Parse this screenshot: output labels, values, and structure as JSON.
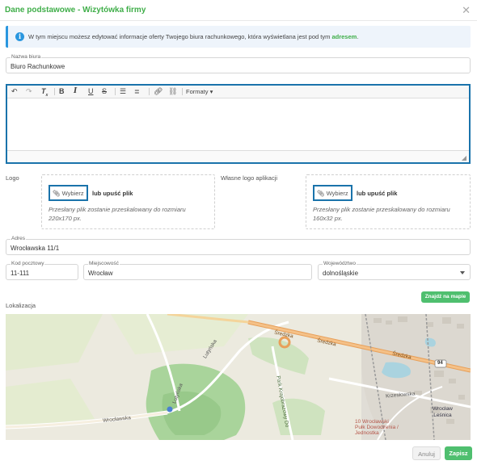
{
  "dialog": {
    "title": "Dane podstawowe - Wizytówka firmy"
  },
  "info": {
    "text": "W tym miejscu możesz edytować informacje oferty Twojego biura rachunkowego, która wyświetlana jest pod tym",
    "link": "adresem",
    "end": "."
  },
  "office": {
    "label": "Nazwa biura",
    "value": "Biuro Rachunkowe"
  },
  "editor": {
    "formats_label": "Formaty",
    "content": ""
  },
  "logo": {
    "label": "Logo",
    "choose_label": "Wybierz",
    "or_drop": "lub upuść plik",
    "hint_line1": "Przesłany plik zostanie przeskalowany do rozmiaru",
    "hint_line2": "220x170 px."
  },
  "app_logo": {
    "label": "Własne logo aplikacji",
    "choose_label": "Wybierz",
    "or_drop": "lub upuść plik",
    "hint_line1": "Przesłany plik zostanie przeskalowany do rozmiaru",
    "hint_line2": "160x32 px."
  },
  "address": {
    "street_label": "Adres",
    "street_value": "Wrocławska 11/1",
    "postal_label": "Kod pocztowy",
    "postal_value": "11-111",
    "city_label": "Miejscowość",
    "city_value": "Wrocław",
    "province_label": "Województwo",
    "province_value": "dolnośląskie"
  },
  "location": {
    "label": "Lokalizacja",
    "find_label": "Znajdź na mapie"
  },
  "map": {
    "labels": {
      "sredzka_1": "Średzka",
      "sredzka_2": "Średzka",
      "sredzka_3": "Średzka",
      "lutynska_1": "Lutyńska",
      "lutynska_2": "Lutyńska",
      "wroclawska": "Wrocławska",
      "park": "Park Krajobrazowy Do",
      "krzeslowska": "Krzesłowska",
      "pomnik_1": "10 Wrocławski",
      "pomnik_2": "Pułk Dowodzenia /",
      "pomnik_3": "Jednostka",
      "wroclaw_lesnica_1": "Wrocław",
      "wroclaw_lesnica_2": "Leśnica",
      "road_num": "94"
    }
  },
  "footer": {
    "cancel_label": "Anuluj",
    "save_label": "Zapisz"
  },
  "colors": {
    "accent": "#3fae49",
    "focus": "#1a73ab",
    "info": "#2a97df",
    "save": "#4fbf6f"
  }
}
